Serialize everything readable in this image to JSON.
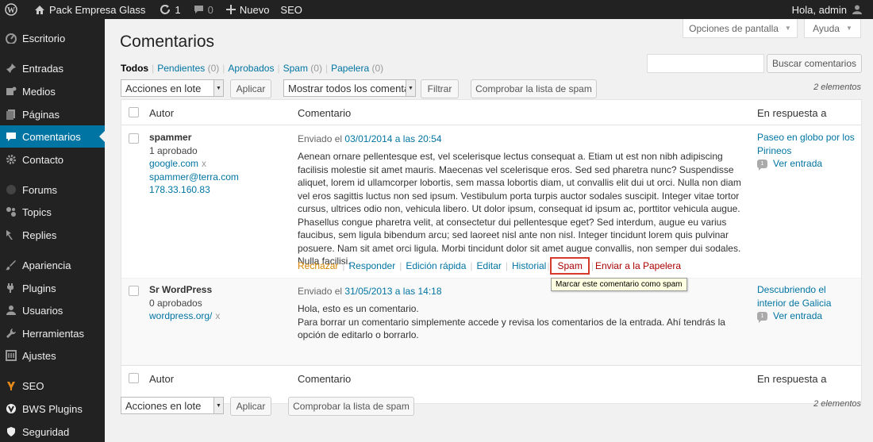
{
  "adminbar": {
    "site_name": "Pack Empresa Glass",
    "updates_count": "1",
    "comments_count": "0",
    "new_label": "Nuevo",
    "seo_label": "SEO",
    "greeting": "Hola, admin"
  },
  "sidebar": {
    "items": [
      {
        "label": "Escritorio",
        "icon": "dashboard-icon"
      },
      {
        "label": "Entradas",
        "icon": "pin-icon"
      },
      {
        "label": "Medios",
        "icon": "media-icon"
      },
      {
        "label": "Páginas",
        "icon": "pages-icon"
      },
      {
        "label": "Comentarios",
        "icon": "comments-icon",
        "current": true
      },
      {
        "label": "Contacto",
        "icon": "gear-icon"
      },
      {
        "label": "Forums",
        "icon": "forums-icon"
      },
      {
        "label": "Topics",
        "icon": "topics-icon"
      },
      {
        "label": "Replies",
        "icon": "replies-icon"
      },
      {
        "label": "Apariencia",
        "icon": "brush-icon"
      },
      {
        "label": "Plugins",
        "icon": "plugin-icon"
      },
      {
        "label": "Usuarios",
        "icon": "users-icon"
      },
      {
        "label": "Herramientas",
        "icon": "wrench-icon"
      },
      {
        "label": "Ajustes",
        "icon": "settings-icon"
      },
      {
        "label": "SEO",
        "icon": "seo-icon"
      },
      {
        "label": "BWS Plugins",
        "icon": "bws-icon"
      },
      {
        "label": "Seguridad",
        "icon": "shield-icon"
      }
    ]
  },
  "screen_options": "Opciones de pantalla",
  "help": "Ayuda",
  "page_title": "Comentarios",
  "filters": {
    "all": "Todos",
    "pending": "Pendientes",
    "pending_count": "(0)",
    "approved": "Aprobados",
    "spam": "Spam",
    "spam_count": "(0)",
    "trash": "Papelera",
    "trash_count": "(0)"
  },
  "search": {
    "button": "Buscar comentarios",
    "value": ""
  },
  "bulk": {
    "select": "Acciones en lote",
    "apply": "Aplicar",
    "show_all": "Mostrar todos los comenta",
    "filter": "Filtrar",
    "check_spam": "Comprobar la lista de spam"
  },
  "count_text": "2 elementos",
  "columns": {
    "author": "Autor",
    "comment": "Comentario",
    "response": "En respuesta a"
  },
  "comments": [
    {
      "author": "spammer",
      "approved": "1 aprobado",
      "url": "google.com",
      "url_x": "x",
      "email": "spammer@terra.com",
      "ip": "178.33.160.83",
      "submitted_prefix": "Enviado el",
      "date": "03/01/2014 a las 20:54",
      "text": "Aenean ornare pellentesque est, vel scelerisque lectus consequat a. Etiam ut est non nibh adipiscing facilisis molestie sit amet mauris. Maecenas vel scelerisque eros. Sed sed pharetra nunc? Suspendisse aliquet, lorem id ullamcorper lobortis, sem massa lobortis diam, ut convallis elit dui ut orci. Nulla non diam vel eros sagittis luctus non sed ipsum. Vestibulum porta turpis auctor sodales suscipit. Integer vitae tortor cursus, ultrices odio non, vehicula libero. Ut dolor ipsum, consequat id ipsum ac, porttitor vehicula augue. Phasellus congue pharetra velit, at consectetur dui pellentesque eget? Sed interdum, augue eu varius faucibus, sem ligula bibendum arcu; sed laoreet nisl ante non nisl. Integer tincidunt lorem quis pulvinar posuere. Nam sit amet orci ligula. Morbi tincidunt dolor sit amet augue convallis, non semper dui sodales. Nulla facilisi.",
      "actions": {
        "reject": "Rechazar",
        "reply": "Responder",
        "quick_edit": "Edición rápida",
        "edit": "Editar",
        "history": "Historial",
        "spam": "Spam",
        "trash": "Enviar a la Papelera"
      },
      "tooltip": "Marcar este comentario como spam",
      "response_title": "Paseo en globo por los Pirineos",
      "view_post": "Ver entrada",
      "bubble_count": "1"
    },
    {
      "author": "Sr WordPress",
      "approved": "0 aprobados",
      "url": "wordpress.org/",
      "url_x": "x",
      "submitted_prefix": "Enviado el",
      "date": "31/05/2013 a las 14:18",
      "text_line1": "Hola, esto es un comentario.",
      "text_line2": "Para borrar un comentario simplemente accede y revisa los comentarios de la entrada. Ahí tendrás la opción de editarlo o borrarlo.",
      "response_title": "Descubriendo el interior de Galicia",
      "view_post": "Ver entrada",
      "bubble_count": "1"
    }
  ],
  "colors": {
    "accent": "#0074a2",
    "adminbar": "#222222",
    "highlight": "#d53a2a"
  }
}
